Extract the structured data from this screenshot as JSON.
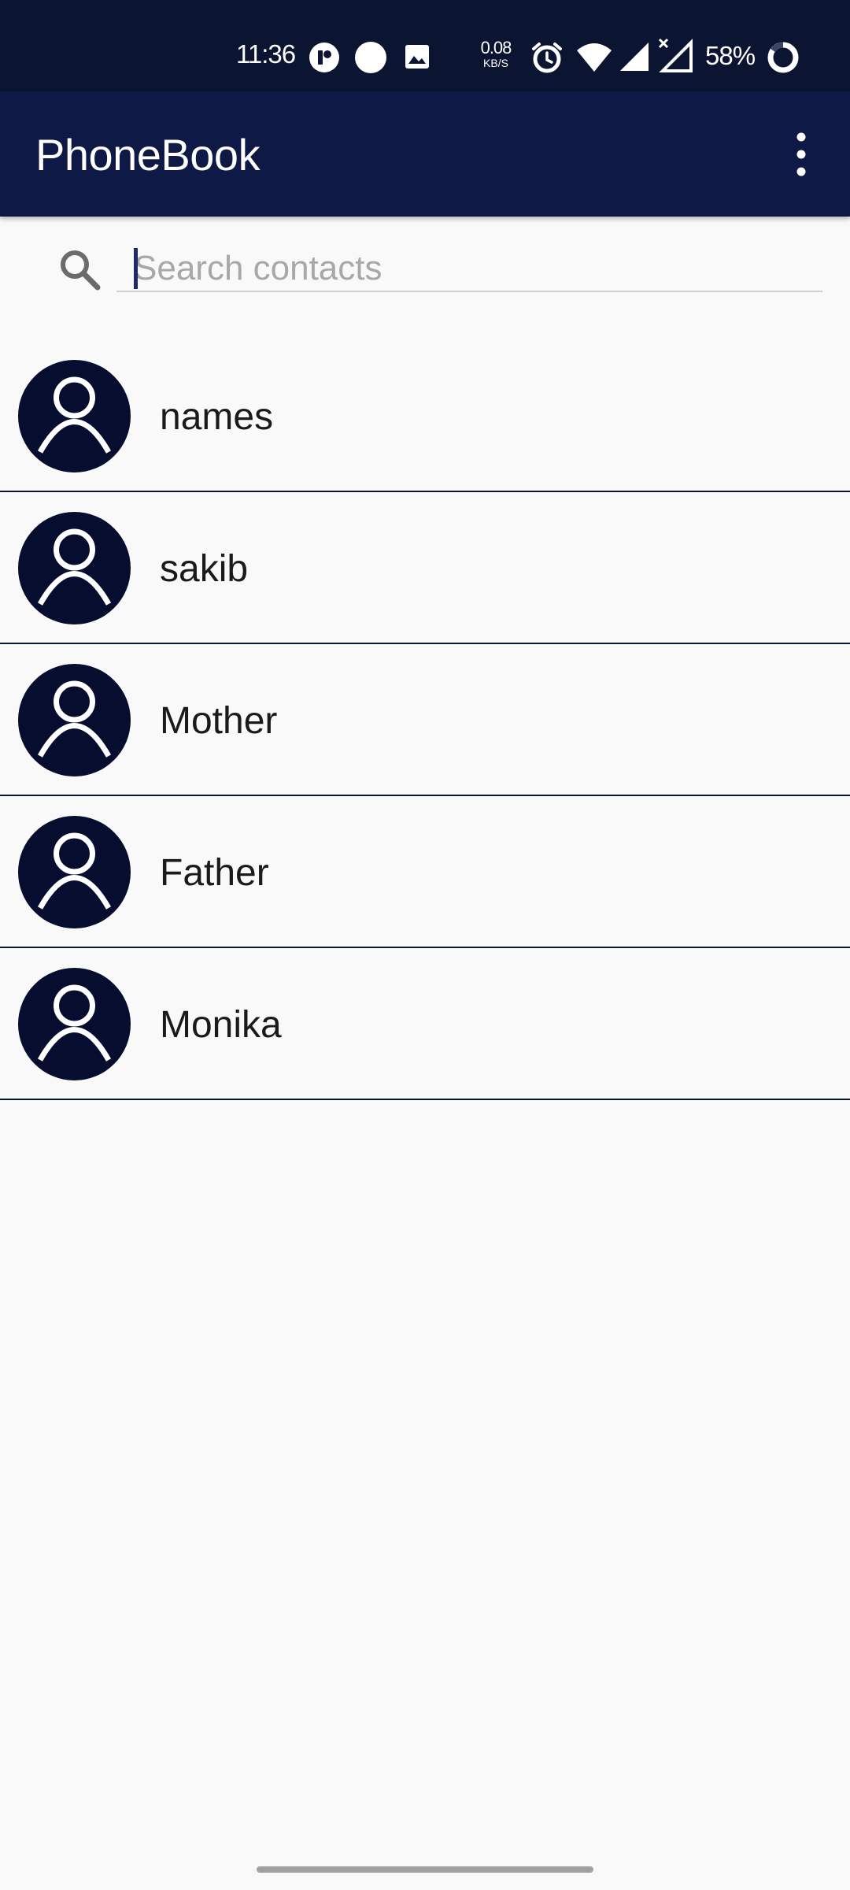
{
  "status_bar": {
    "time": "11:36",
    "net_speed_value": "0.08",
    "net_speed_unit": "KB/S",
    "battery_percent": "58%",
    "icons": [
      "app-notification-icon",
      "dot-notification-icon",
      "image-icon",
      "alarm-icon",
      "wifi-icon",
      "signal-icon",
      "signal-no-data-icon",
      "battery-ring-icon"
    ]
  },
  "app_bar": {
    "title": "PhoneBook",
    "menu_icon": "more-vert-icon"
  },
  "search": {
    "placeholder": "Search contacts",
    "value": "",
    "icon": "search-icon"
  },
  "contacts": [
    {
      "name": "names"
    },
    {
      "name": "sakib"
    },
    {
      "name": "Mother"
    },
    {
      "name": "Father"
    },
    {
      "name": "Monika"
    }
  ],
  "colors": {
    "status_bar_bg": "#0b1532",
    "app_bar_bg": "#0e1a45",
    "avatar_bg": "#060d2e",
    "divider": "#0b1532",
    "page_bg": "#f9f9f9"
  }
}
